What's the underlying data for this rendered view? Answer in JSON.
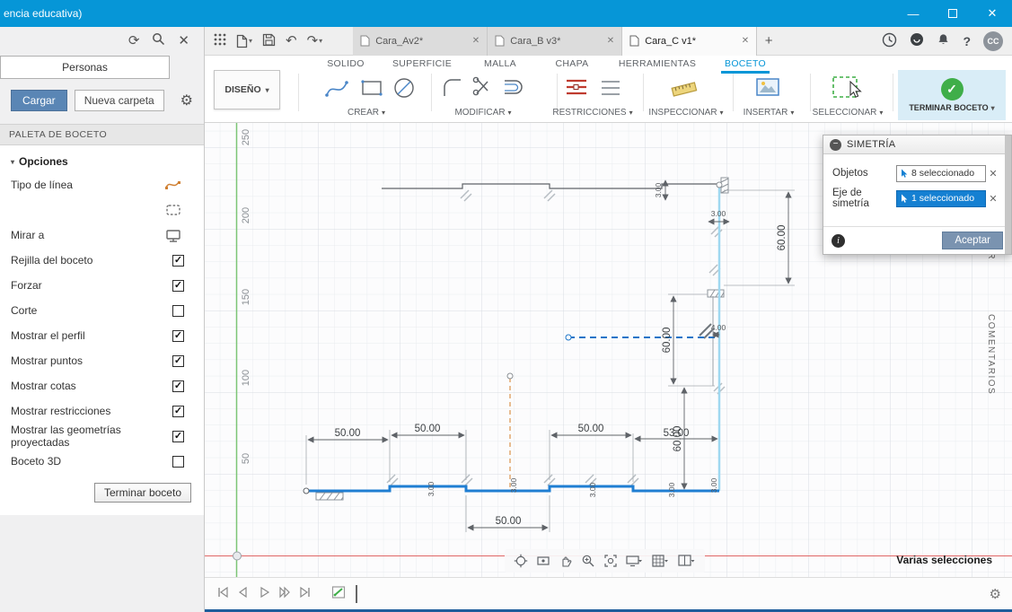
{
  "colors": {
    "titlebar": "#0696d7",
    "accent": "#0696d7",
    "selection_blue": "#1f7ed2",
    "axis_green": "#7cc576",
    "axis_red": "#e06666",
    "construction_orange": "#dfa264",
    "finish_green": "#3fae49",
    "finish_bg": "#d9edf7",
    "selected_field_blue": "#1580d2"
  },
  "icons": {
    "minimize": "—",
    "close": "✕",
    "refresh": "⟳",
    "gear": "⚙",
    "undo": "↶",
    "redo": "↷",
    "plus": "+",
    "caret": "▾",
    "question": "?",
    "info": "i",
    "collapse": "−",
    "check": "✓"
  },
  "header": {
    "title": "encia educativa)",
    "avatar": "CC"
  },
  "doc_tabs": [
    {
      "label": "Cara_Av2*"
    },
    {
      "label": "Cara_B v3*"
    },
    {
      "label": "Cara_C v1*"
    }
  ],
  "ribbon": {
    "design": "DISEÑO",
    "env_tabs": [
      "SOLIDO",
      "SUPERFICIE",
      "MALLA",
      "CHAPA",
      "HERRAMIENTAS",
      "BOCETO"
    ],
    "groups": [
      "CREAR",
      "MODIFICAR",
      "RESTRICCIONES",
      "INSPECCIONAR",
      "INSERTAR",
      "SELECCIONAR"
    ],
    "finish": "TERMINAR BOCETO"
  },
  "left_panel": {
    "personas": "Personas",
    "cargar": "Cargar",
    "nueva_carpeta": "Nueva carpeta",
    "palette_title": "PALETA DE BOCETO",
    "options_title": "Opciones",
    "options": [
      {
        "label": "Tipo de línea",
        "control": "icon",
        "icon": "line-type-icon"
      },
      {
        "label": "",
        "control": "icon",
        "icon": "construction-line-icon"
      },
      {
        "label": "Mirar a",
        "control": "icon",
        "icon": "look-at-icon"
      },
      {
        "label": "Rejilla del boceto",
        "control": "checkbox",
        "checked": true
      },
      {
        "label": "Forzar",
        "control": "checkbox",
        "checked": true
      },
      {
        "label": "Corte",
        "control": "checkbox",
        "checked": false
      },
      {
        "label": "Mostrar el perfil",
        "control": "checkbox",
        "checked": true
      },
      {
        "label": "Mostrar puntos",
        "control": "checkbox",
        "checked": true
      },
      {
        "label": "Mostrar cotas",
        "control": "checkbox",
        "checked": true
      },
      {
        "label": "Mostrar restricciones",
        "control": "checkbox",
        "checked": true
      },
      {
        "label": "Mostrar las geometrías proyectadas",
        "control": "checkbox",
        "checked": true
      },
      {
        "label": "Boceto 3D",
        "control": "checkbox",
        "checked": false
      }
    ],
    "finish_button": "Terminar boceto"
  },
  "dialog": {
    "title": "SIMETRÍA",
    "objects_label": "Objetos",
    "objects_value": "8 seleccionado",
    "axis_label": "Eje de simetría",
    "axis_value": "1 seleccionado",
    "ok": "Aceptar"
  },
  "canvas": {
    "ruler": [
      "250",
      "200",
      "150",
      "100",
      "50"
    ],
    "dims": {
      "w1": "50.00",
      "w2": "50.00",
      "w3": "50.00",
      "w4": "53.00",
      "w5": "50.00",
      "h_top": "60.00",
      "h_mid": "60.00",
      "h_bot": "60.00",
      "t_top": "3.00",
      "t_topright": "3.00",
      "gap": "4.00",
      "s1": "3.00",
      "s2": "3.00",
      "s3": "3.00",
      "s4": "3.00",
      "s5": "3.00"
    },
    "status": "Varias selecciones",
    "comments_tab": "COMENTARIOS",
    "right_tab_partial": "OR"
  }
}
